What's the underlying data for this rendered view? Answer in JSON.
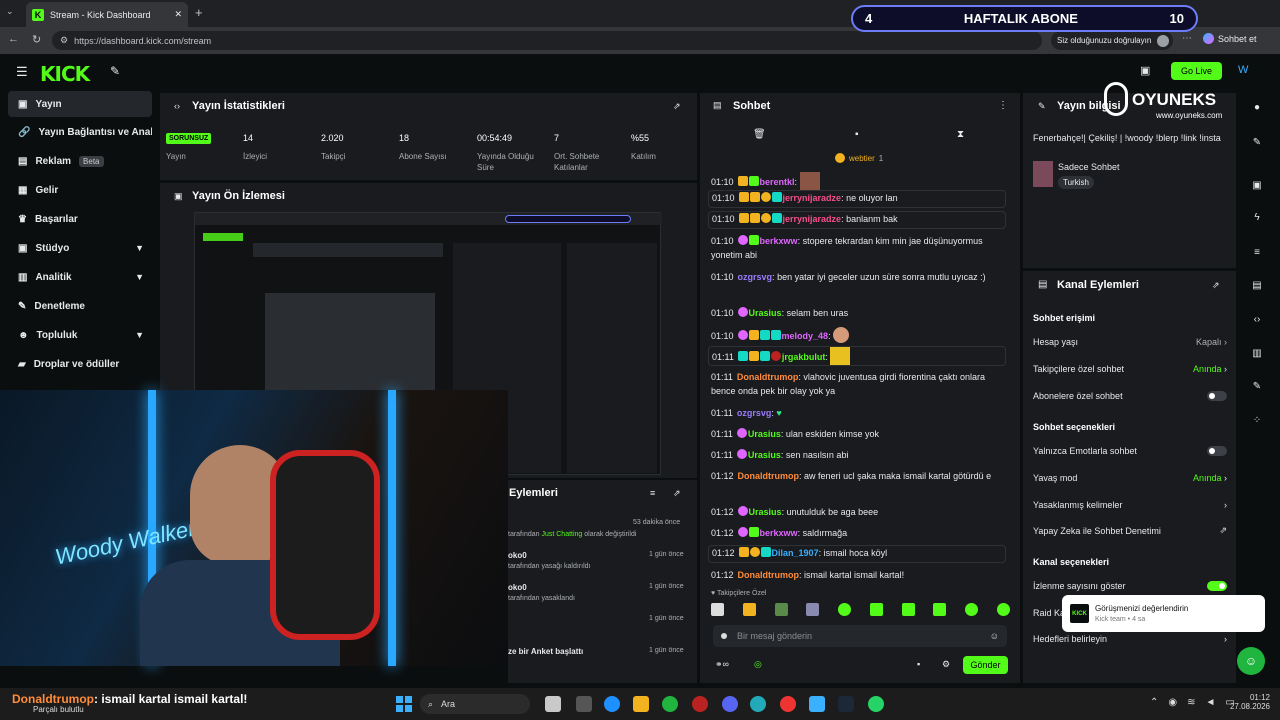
{
  "browser": {
    "tab_title": "Stream - Kick Dashboard",
    "url": "https://dashboard.kick.com/stream",
    "verify_text": "Siz olduğunuzu doğrulayın",
    "profile_label": "Sohbet et"
  },
  "overlay": {
    "sub_goal_current": "4",
    "sub_goal_label": "HAFTALIK ABONE",
    "sub_goal_target": "10",
    "brand": "OYUNEKS",
    "brand_url": "www.oyuneks.com"
  },
  "header": {
    "logo": "KICK",
    "go_live": "Go Live"
  },
  "sidebar": {
    "items": [
      {
        "label": "Yayın"
      },
      {
        "label": "Yayın Bağlantısı ve Anahtar"
      },
      {
        "label": "Reklam",
        "badge": "Beta"
      },
      {
        "label": "Gelir"
      },
      {
        "label": "Başarılar"
      },
      {
        "label": "Stüdyo"
      },
      {
        "label": "Analitik"
      },
      {
        "label": "Denetleme"
      },
      {
        "label": "Topluluk"
      },
      {
        "label": "Droplar ve ödüller"
      }
    ]
  },
  "stats": {
    "title": "Yayın İstatistikleri",
    "items": [
      {
        "value": "SORUNSUZ",
        "label": "Yayın"
      },
      {
        "value": "14",
        "label": "İzleyici"
      },
      {
        "value": "2.020",
        "label": "Takipçi"
      },
      {
        "value": "18",
        "label": "Abone Sayısı"
      },
      {
        "value": "00:54:49",
        "label": "Yayında Olduğu Süre"
      },
      {
        "value": "7",
        "label": "Ort. Sohbete Katılanlar"
      },
      {
        "value": "%55",
        "label": "Katılım"
      }
    ]
  },
  "preview": {
    "title": "Yayın Ön İzlemesi"
  },
  "actions_panel": {
    "title": "Eylemleri",
    "rows": [
      {
        "text_prefix": "tarafından ",
        "highlight": "Just Chatting",
        "text_suffix": " olarak değiştirildi",
        "time": "53 dakika önce"
      },
      {
        "user": "oko0",
        "text": "tarafından yasağı kaldırıldı",
        "time": "1 gün önce"
      },
      {
        "user": "oko0",
        "text": "tarafından yasaklandı",
        "time": "1 gün önce"
      },
      {
        "user": "",
        "text": "",
        "time": "1 gün önce"
      },
      {
        "user": "ze bir Anket başlattı",
        "text": "",
        "time": "1 gün önce"
      }
    ]
  },
  "chat": {
    "title": "Sohbet",
    "pinned": "webtier",
    "pinned_count": "1",
    "messages": [
      {
        "time": "01:10",
        "user": "berentkl",
        "text": "",
        "color": "#53fc18"
      },
      {
        "time": "01:10",
        "user": "jerrynijaradze",
        "text": "ne oluyor lan",
        "color": "#f64e8b"
      },
      {
        "time": "01:10",
        "user": "jerrynijaradze",
        "text": "banlanm bak",
        "color": "#f64e8b"
      },
      {
        "time": "01:10",
        "user": "berkxww",
        "text": "stopere tekrardan kim min jae düşünuyormus yonetim abi",
        "color": "#e066ff"
      },
      {
        "time": "01:10",
        "user": "ozgrsvg",
        "text": "ben yatar iyi geceler uzun süre sonra mutlu uyıcaz :)",
        "color": "#9b7bff"
      },
      {
        "time": "01:10",
        "user": "Urasius",
        "text": "selam ben uras",
        "color": "#53fc18"
      },
      {
        "time": "01:10",
        "user": "melody_48",
        "text": "",
        "color": "#e066ff"
      },
      {
        "time": "01:11",
        "user": "jrgakbulut",
        "text": "",
        "color": "#53fc18"
      },
      {
        "time": "01:11",
        "user": "Donaldtrumop",
        "text": "vlahovic juventusa girdi fiorentina çaktı onlara bence onda pek bir olay yok ya",
        "color": "#ff8c3a"
      },
      {
        "time": "01:11",
        "user": "ozgrsvg",
        "text": "",
        "color": "#9b7bff"
      },
      {
        "time": "01:11",
        "user": "Urasius",
        "text": "ulan eskiden kimse yok",
        "color": "#53fc18"
      },
      {
        "time": "01:11",
        "user": "Urasius",
        "text": "sen nasılsın abi",
        "color": "#53fc18"
      },
      {
        "time": "01:12",
        "user": "Donaldtrumop",
        "text": "aw feneri ucl şaka maka ismail kartal götürdü e",
        "color": "#ff8c3a"
      },
      {
        "time": "01:12",
        "user": "Urasius",
        "text": "unutulduk be aga beee",
        "color": "#53fc18"
      },
      {
        "time": "01:12",
        "user": "berkxww",
        "text": "saldırmağa",
        "color": "#e066ff"
      },
      {
        "time": "01:12",
        "user": "Dilan_1907",
        "text": "ismail hoca köyl",
        "color": "#3ab0ff"
      },
      {
        "time": "01:12",
        "user": "Donaldtrumop",
        "text": "ismail kartal ismail kartal!",
        "color": "#ff8c3a"
      }
    ],
    "followers_label": "Takipçilere Özel",
    "input_placeholder": "Bir mesaj gönderin",
    "send_label": "Gönder"
  },
  "stream_info": {
    "title": "Yayın bilgisi",
    "stream_title": "Fenerbahçe!| Çekiliş! | !woody !blerp !link !insta",
    "category": "Sadece Sohbet",
    "tag": "Turkish"
  },
  "channel_actions": {
    "title": "Kanal Eylemleri",
    "chat_access": "Sohbet erişimi",
    "account_age": {
      "label": "Hesap yaşı",
      "value": "Kapalı"
    },
    "followers_only": {
      "label": "Takipçilere özel sohbet",
      "value": "Anında"
    },
    "subs_only": {
      "label": "Abonelere özel sohbet"
    },
    "chat_options": "Sohbet seçenekleri",
    "emotes_only": {
      "label": "Yalnızca Emotlarla sohbet"
    },
    "slow_mode": {
      "label": "Yavaş mod",
      "value": "Anında"
    },
    "banned_words": {
      "label": "Yasaklanmış kelimeler"
    },
    "ai_moderation": {
      "label": "Yapay Zeka ile Sohbet Denetimi"
    },
    "channel_options": "Kanal seçenekleri",
    "show_viewers": {
      "label": "İzlenme sayısını göster"
    },
    "raid": {
      "label": "Raid Ka"
    },
    "goals": {
      "label": "Hedefleri belirleyin"
    }
  },
  "toast": {
    "title": "Görüşmenizi değerlendirin",
    "sub": "Kick team • 4 sa"
  },
  "ticker": {
    "user": "Donaldtrumop",
    "text": ": ismail kartal ismail kartal!",
    "status": "Parçalı bulutlu"
  },
  "taskbar": {
    "search": "Ara",
    "time": "01:12",
    "date": "27.08.2026"
  }
}
